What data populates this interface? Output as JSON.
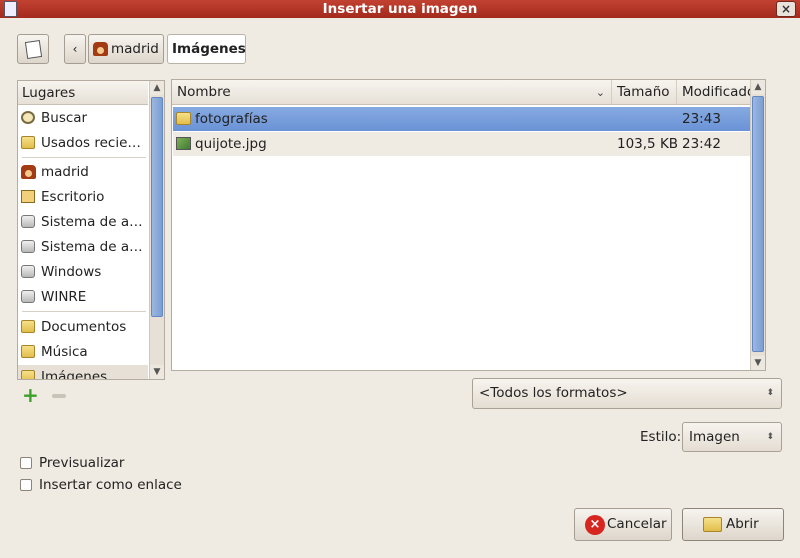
{
  "window": {
    "title": "Insertar una imagen",
    "close_label": "×"
  },
  "toolbar": {
    "back_label": "‹"
  },
  "breadcrumb": [
    {
      "label": "madrid",
      "icon": "home-icon"
    },
    {
      "label": "Imágenes"
    }
  ],
  "places": {
    "header": "Lugares",
    "items": [
      {
        "label": "Buscar",
        "icon": "search-icon"
      },
      {
        "label": "Usados recie…",
        "icon": "folder-icon"
      },
      {
        "label": "madrid",
        "icon": "home-icon"
      },
      {
        "label": "Escritorio",
        "icon": "desktop-icon"
      },
      {
        "label": "Sistema de a…",
        "icon": "drive-icon"
      },
      {
        "label": "Sistema de a…",
        "icon": "drive-icon"
      },
      {
        "label": "Windows",
        "icon": "drive-icon"
      },
      {
        "label": "WINRE",
        "icon": "drive-icon"
      },
      {
        "label": "Documentos",
        "icon": "folder-icon"
      },
      {
        "label": "Música",
        "icon": "folder-icon"
      },
      {
        "label": "Imágenes",
        "icon": "folder-icon"
      }
    ],
    "add_label": "+"
  },
  "files": {
    "columns": [
      "Nombre",
      "Tamaño",
      "Modificado"
    ],
    "sort_indicator": "⌄",
    "rows": [
      {
        "name": "fotografías",
        "size": "",
        "modified": "23:43",
        "icon": "folder-icon"
      },
      {
        "name": "quijote.jpg",
        "size": "103,5 KB",
        "modified": "23:42",
        "icon": "image-file-icon"
      }
    ]
  },
  "filter": {
    "value": "<Todos los formatos>"
  },
  "style": {
    "label": "Estilo:",
    "value": "Imagen"
  },
  "options": {
    "preview_label": "Previsualizar",
    "insert_as_link_label": "Insertar como enlace"
  },
  "buttons": {
    "cancel_label": "Cancelar",
    "open_label": "Abrir"
  },
  "colors": {
    "titlebar": "#b3382a",
    "selection": "#7a9fd9",
    "accent_green": "#3aa12a"
  }
}
